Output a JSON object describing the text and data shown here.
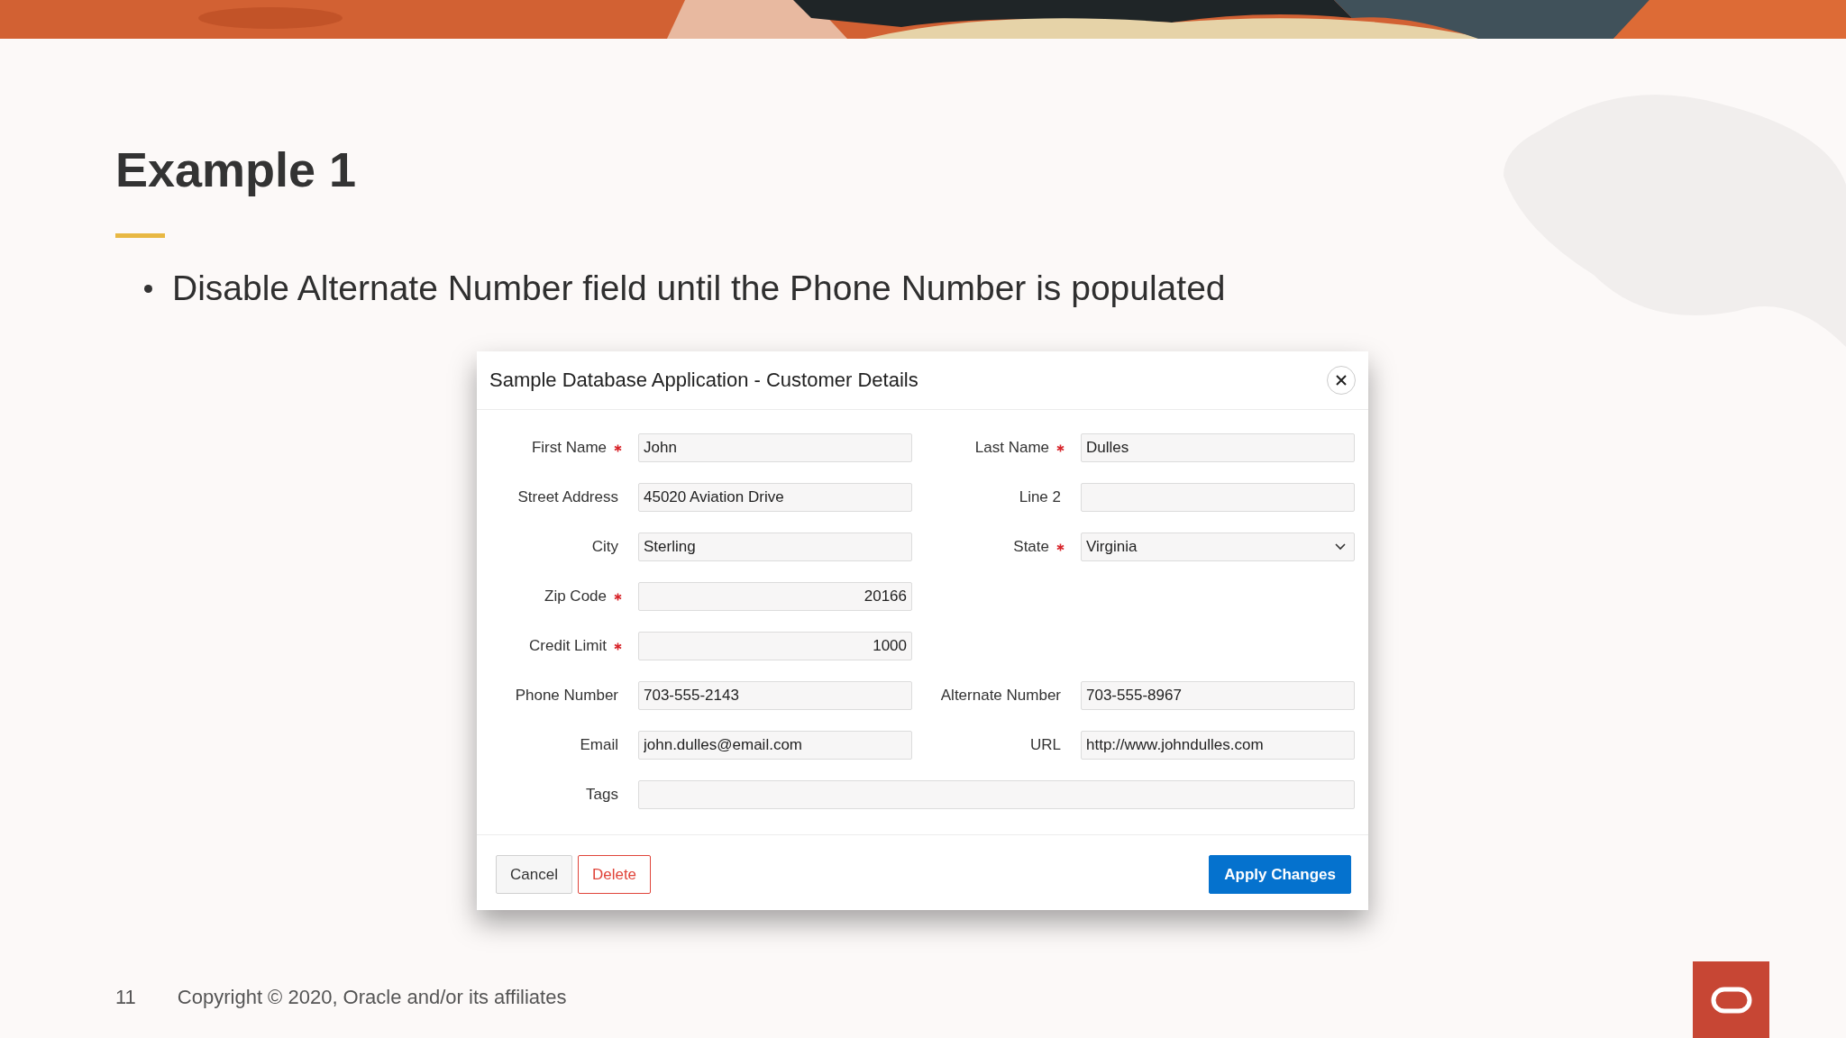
{
  "slide": {
    "title": "Example 1",
    "bullet": "Disable Alternate Number field until the Phone Number is populated"
  },
  "dialog": {
    "title": "Sample Database Application - Customer Details",
    "rows": [
      {
        "fields": [
          {
            "label": "First Name",
            "required": true,
            "kind": "text",
            "value": "John"
          },
          {
            "label": "Last Name",
            "required": true,
            "kind": "text",
            "value": "Dulles"
          }
        ]
      },
      {
        "fields": [
          {
            "label": "Street Address",
            "required": false,
            "kind": "text",
            "value": "45020 Aviation Drive"
          },
          {
            "label": "Line 2",
            "required": false,
            "kind": "text"
          }
        ]
      },
      {
        "fields": [
          {
            "label": "City",
            "required": false,
            "kind": "text",
            "value": "Sterling"
          },
          {
            "label": "State",
            "required": true,
            "kind": "select",
            "value": "Virginia"
          }
        ]
      },
      {
        "fields": [
          {
            "label": "Zip Code",
            "required": true,
            "kind": "number",
            "value": "20166"
          }
        ]
      },
      {
        "fields": [
          {
            "label": "Credit Limit",
            "required": true,
            "kind": "number",
            "value": "1000"
          }
        ]
      },
      {
        "fields": [
          {
            "label": "Phone Number",
            "required": false,
            "kind": "text",
            "value": "703-555-2143"
          },
          {
            "label": "Alternate Number",
            "required": false,
            "kind": "text",
            "value": "703-555-8967"
          }
        ]
      },
      {
        "fields": [
          {
            "label": "Email",
            "required": false,
            "kind": "text",
            "value": "john.dulles@email.com"
          },
          {
            "label": "URL",
            "required": false,
            "kind": "text",
            "value": "http://www.johndulles.com"
          }
        ]
      },
      {
        "fields": [
          {
            "label": "Tags",
            "required": false,
            "kind": "wide"
          }
        ]
      }
    ],
    "buttons": [
      {
        "label": "Cancel",
        "kind": "plain"
      },
      {
        "label": "Delete",
        "kind": "danger"
      },
      {
        "label": "Apply Changes",
        "kind": "primary"
      }
    ]
  },
  "footer": {
    "page": "11",
    "copyright": "Copyright © 2020, Oracle and/or its affiliates"
  }
}
